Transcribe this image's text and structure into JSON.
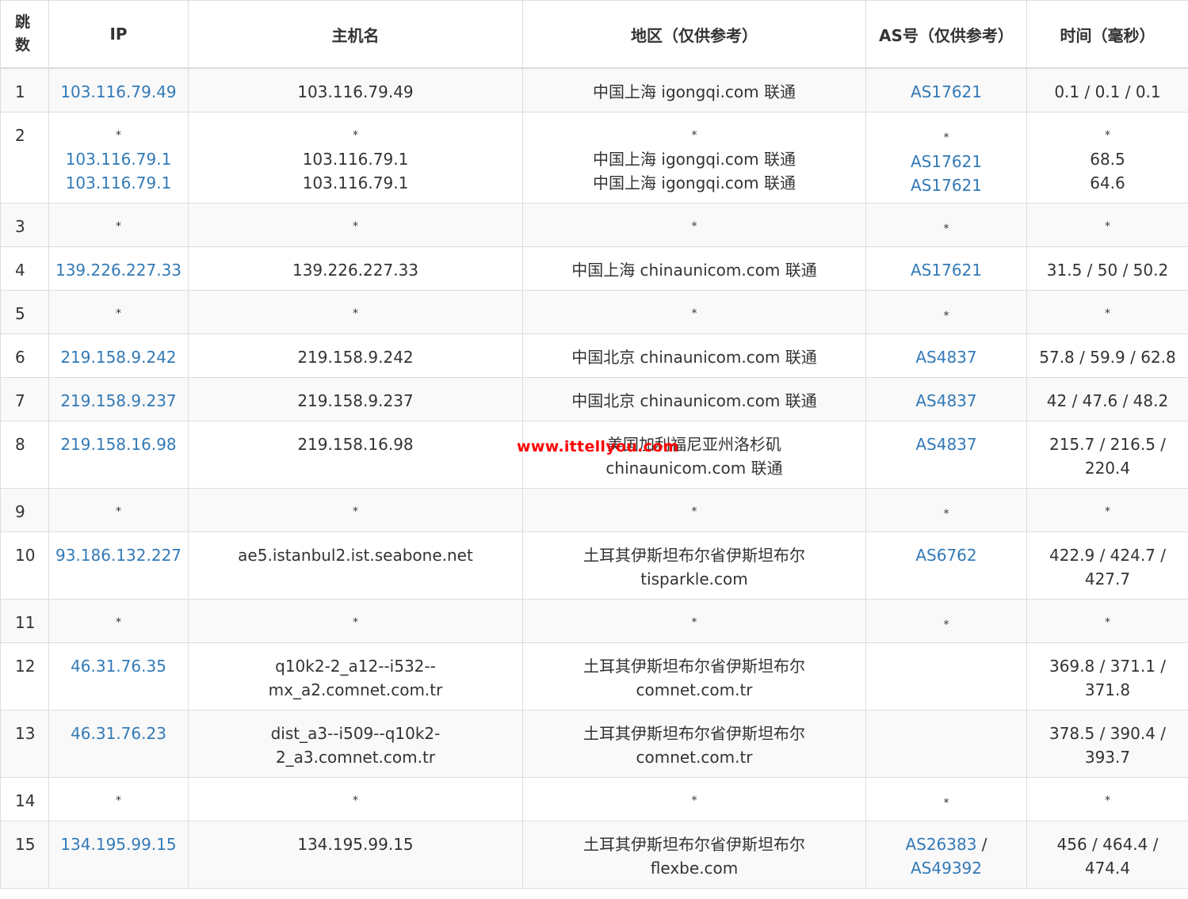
{
  "colors": {
    "link": "#337ab7",
    "text": "#333333",
    "stripe": "#f9f9f9",
    "border": "#dddddd",
    "watermark": "#ff0000"
  },
  "header": {
    "hop": "跳数",
    "ip": "IP",
    "hostname": "主机名",
    "region": "地区（仅供参考）",
    "as": "AS号（仅供参考）",
    "time": "时间（毫秒）"
  },
  "watermark": "www.ittellyou.com",
  "rows": [
    {
      "hop": "1",
      "ip": [
        "103.116.79.49"
      ],
      "host": [
        "103.116.79.49"
      ],
      "region": [
        "中国上海 igongqi.com 联通"
      ],
      "as": [
        [
          "AS17621"
        ]
      ],
      "time": [
        "0.1 / 0.1 / 0.1"
      ]
    },
    {
      "hop": "2",
      "ip": [
        "*",
        "103.116.79.1",
        "103.116.79.1"
      ],
      "host": [
        "*",
        "103.116.79.1",
        "103.116.79.1"
      ],
      "region": [
        "*",
        "中国上海 igongqi.com 联通",
        "中国上海 igongqi.com 联通"
      ],
      "as": [
        [
          "*"
        ],
        [
          "AS17621"
        ],
        [
          "AS17621"
        ]
      ],
      "time": [
        "*",
        "68.5",
        "64.6"
      ]
    },
    {
      "hop": "3",
      "ip": [
        "*"
      ],
      "host": [
        "*"
      ],
      "region": [
        "*"
      ],
      "as": [
        [
          "*"
        ]
      ],
      "time": [
        "*"
      ]
    },
    {
      "hop": "4",
      "ip": [
        "139.226.227.33"
      ],
      "host": [
        "139.226.227.33"
      ],
      "region": [
        "中国上海 chinaunicom.com 联通"
      ],
      "as": [
        [
          "AS17621"
        ]
      ],
      "time": [
        "31.5 / 50 / 50.2"
      ]
    },
    {
      "hop": "5",
      "ip": [
        "*"
      ],
      "host": [
        "*"
      ],
      "region": [
        "*"
      ],
      "as": [
        [
          "*"
        ]
      ],
      "time": [
        "*"
      ]
    },
    {
      "hop": "6",
      "ip": [
        "219.158.9.242"
      ],
      "host": [
        "219.158.9.242"
      ],
      "region": [
        "中国北京 chinaunicom.com 联通"
      ],
      "as": [
        [
          "AS4837"
        ]
      ],
      "time": [
        "57.8 / 59.9 / 62.8"
      ]
    },
    {
      "hop": "7",
      "ip": [
        "219.158.9.237"
      ],
      "host": [
        "219.158.9.237"
      ],
      "region": [
        "中国北京 chinaunicom.com 联通"
      ],
      "as": [
        [
          "AS4837"
        ]
      ],
      "time": [
        "42 / 47.6 / 48.2"
      ]
    },
    {
      "hop": "8",
      "ip": [
        "219.158.16.98"
      ],
      "host": [
        "219.158.16.98"
      ],
      "region": [
        "美国加利福尼亚州洛杉矶",
        "chinaunicom.com 联通"
      ],
      "as": [
        [
          "AS4837"
        ]
      ],
      "time": [
        "215.7 / 216.5 /",
        "220.4"
      ]
    },
    {
      "hop": "9",
      "ip": [
        "*"
      ],
      "host": [
        "*"
      ],
      "region": [
        "*"
      ],
      "as": [
        [
          "*"
        ]
      ],
      "time": [
        "*"
      ]
    },
    {
      "hop": "10",
      "ip": [
        "93.186.132.227"
      ],
      "host": [
        "ae5.istanbul2.ist.seabone.net"
      ],
      "region": [
        "土耳其伊斯坦布尔省伊斯坦布尔",
        "tisparkle.com"
      ],
      "as": [
        [
          "AS6762"
        ]
      ],
      "time": [
        "422.9 / 424.7 /",
        "427.7"
      ]
    },
    {
      "hop": "11",
      "ip": [
        "*"
      ],
      "host": [
        "*"
      ],
      "region": [
        "*"
      ],
      "as": [
        [
          "*"
        ]
      ],
      "time": [
        "*"
      ]
    },
    {
      "hop": "12",
      "ip": [
        "46.31.76.35"
      ],
      "host": [
        "q10k2-2_a12--i532--",
        "mx_a2.comnet.com.tr"
      ],
      "region": [
        "土耳其伊斯坦布尔省伊斯坦布尔",
        "comnet.com.tr"
      ],
      "as": [],
      "time": [
        "369.8 / 371.1 /",
        "371.8"
      ]
    },
    {
      "hop": "13",
      "ip": [
        "46.31.76.23"
      ],
      "host": [
        "dist_a3--i509--q10k2-",
        "2_a3.comnet.com.tr"
      ],
      "region": [
        "土耳其伊斯坦布尔省伊斯坦布尔",
        "comnet.com.tr"
      ],
      "as": [],
      "time": [
        "378.5 / 390.4 /",
        "393.7"
      ]
    },
    {
      "hop": "14",
      "ip": [
        "*"
      ],
      "host": [
        "*"
      ],
      "region": [
        "*"
      ],
      "as": [
        [
          "*"
        ]
      ],
      "time": [
        "*"
      ]
    },
    {
      "hop": "15",
      "ip": [
        "134.195.99.15"
      ],
      "host": [
        "134.195.99.15"
      ],
      "region": [
        "土耳其伊斯坦布尔省伊斯坦布尔",
        "flexbe.com"
      ],
      "as": [
        [
          "AS26383",
          " /"
        ],
        [
          "AS49392"
        ]
      ],
      "time": [
        "456 / 464.4 /",
        "474.4"
      ]
    }
  ]
}
